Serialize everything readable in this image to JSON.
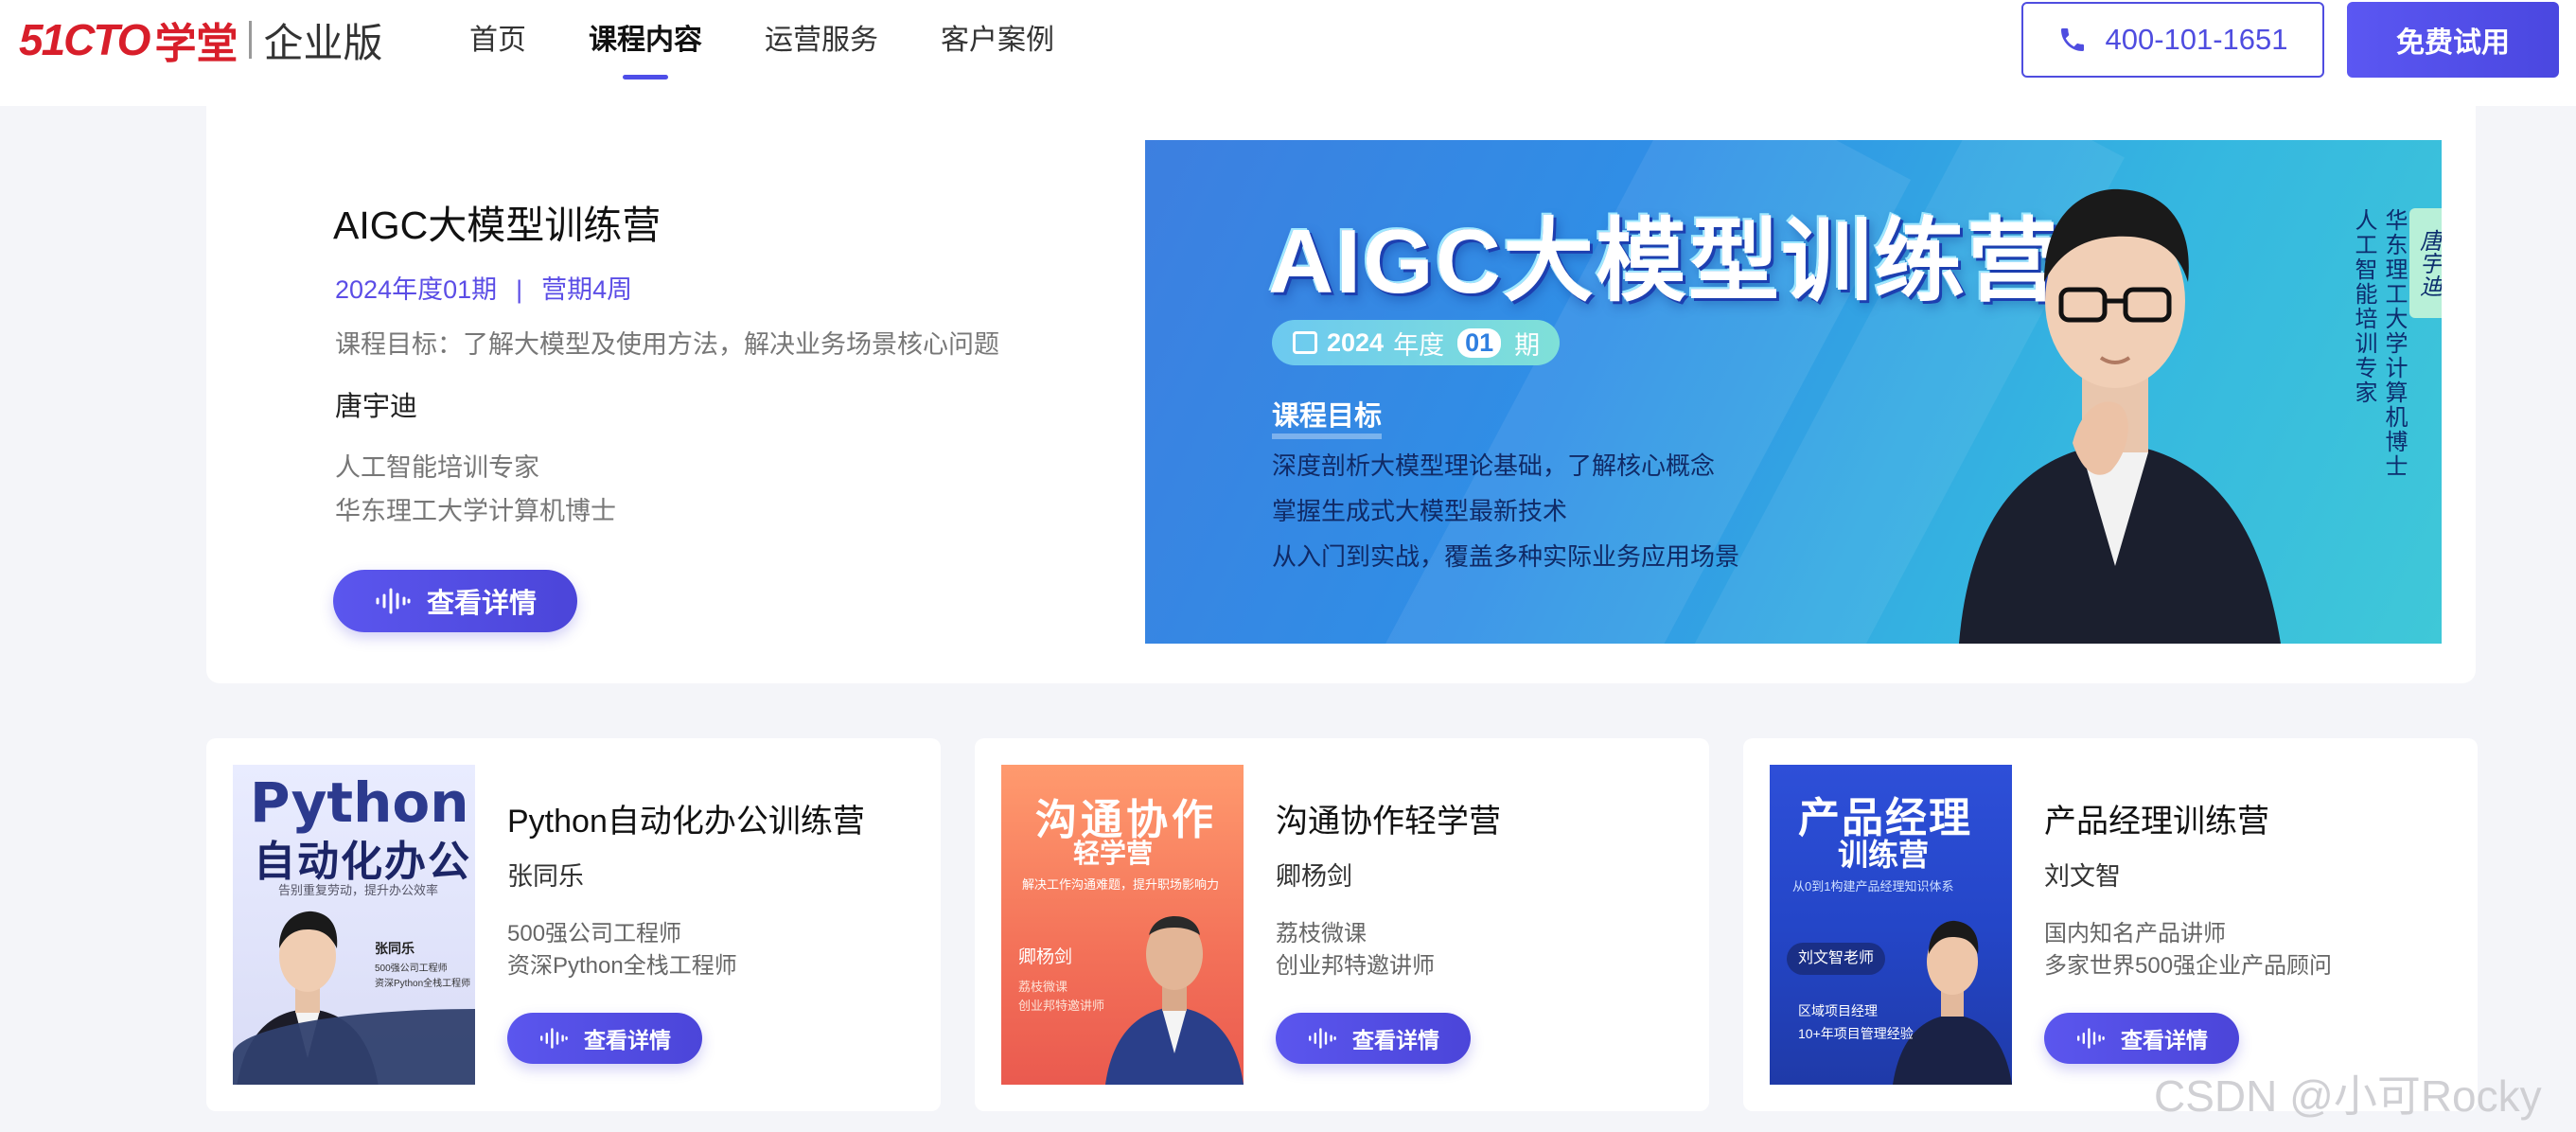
{
  "header": {
    "logo_mark": "51CTO",
    "logo_school": "学堂",
    "logo_edition": "企业版",
    "nav": [
      "首页",
      "课程内容",
      "运营服务",
      "客户案例"
    ],
    "nav_active": "课程内容",
    "phone": "400-101-1651",
    "trial_label": "免费试用",
    "accent_color": "#4f4de0"
  },
  "featured": {
    "title": "AIGC大模型训练营",
    "period": "2024年度01期",
    "meta_sep": "|",
    "duration": "营期4周",
    "goal": "课程目标：了解大模型及使用方法，解决业务场景核心问题",
    "teacher": "唐宇迪",
    "cred1": "人工智能培训专家",
    "cred2": "华东理工大学计算机博士",
    "button": "查看详情",
    "banner": {
      "title": "AIGC大模型训练营",
      "year": "2024",
      "year_unit": "年度",
      "issue": "01",
      "issue_unit": "期",
      "goal_head": "课程目标",
      "lines": [
        "深度剖析大模型理论基础，了解核心概念",
        "掌握生成式大模型最新技术",
        "从入门到实战，覆盖多种实际业务应用场景"
      ],
      "vertical_1": "人工智能培训专家",
      "vertical_2": "华东理工大学计算机博士",
      "name_tag": "唐宇迪"
    }
  },
  "cards": [
    {
      "title": "Python自动化办公训练营",
      "teacher": "张同乐",
      "cred1": "500强公司工程师",
      "cred2": "资深Python全栈工程师",
      "button": "查看详情",
      "cover": {
        "t1": "Python",
        "t2": "自动化办公",
        "sub": "告别重复劳动，提升办公效率",
        "name": "张同乐",
        "l1": "500强公司工程师",
        "l2": "资深Python全栈工程师"
      }
    },
    {
      "title": "沟通协作轻学营",
      "teacher": "卿杨剑",
      "cred1": "荔枝微课",
      "cred2": "创业邦特邀讲师",
      "button": "查看详情",
      "cover": {
        "t1": "沟通协作",
        "t2": "轻学营",
        "sub": "解决工作沟通难题，提升职场影响力",
        "name": "卿杨剑",
        "l1": "荔枝微课",
        "l2": "创业邦特邀讲师"
      }
    },
    {
      "title": "产品经理训练营",
      "teacher": "刘文智",
      "cred1": "国内知名产品讲师",
      "cred2": "多家世界500强企业产品顾问",
      "button": "查看详情",
      "cover": {
        "t1": "产品经理",
        "t2": "训练营",
        "sub": "从0到1构建产品经理知识体系",
        "tag": "刘文智老师",
        "l1": "区域项目经理",
        "l2": "10+年项目管理经验"
      }
    }
  ],
  "watermark": "CSDN @小可Rocky"
}
